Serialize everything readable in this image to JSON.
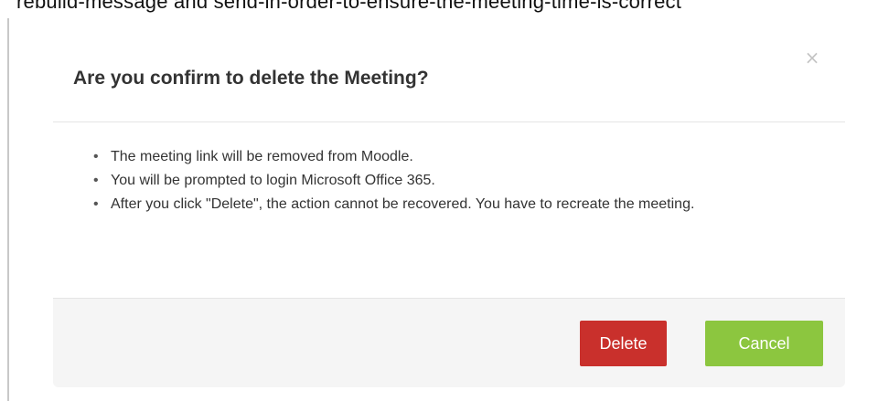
{
  "background": {
    "partial_text": "rebuild-message and send-in-order-to-ensure-the-meeting-time-is-correct"
  },
  "dialog": {
    "title": "Are you confirm to delete the Meeting?",
    "close_label": "×",
    "bullet_glyph": "•",
    "items": [
      "The meeting link will be removed from Moodle.",
      "You will be prompted to login Microsoft Office 365.",
      "After you click \"Delete\", the action cannot be recovered. You have to recreate the meeting."
    ],
    "buttons": {
      "delete_label": "Delete",
      "cancel_label": "Cancel"
    }
  },
  "colors": {
    "delete_button": "#c9302c",
    "cancel_button": "#8cc63f",
    "footer_background": "#f5f5f5",
    "title_text": "#333333"
  }
}
